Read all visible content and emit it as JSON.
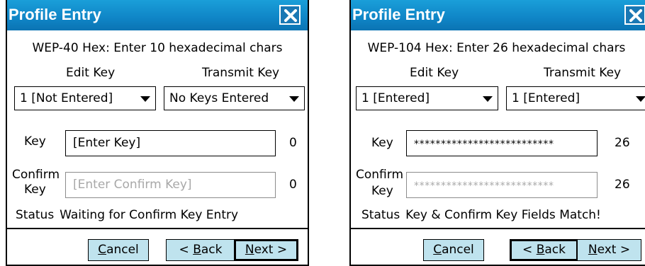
{
  "left": {
    "title": "Profile Entry",
    "heading": "WEP-40 Hex: Enter 10 hexadecimal chars",
    "edit_key_label": "Edit Key",
    "transmit_key_label": "Transmit Key",
    "edit_key_value": "1 [Not Entered]",
    "transmit_key_value": "No Keys Entered",
    "key_label": "Key",
    "key_value": "[Enter Key]",
    "key_count": "0",
    "confirm_label_1": "Confirm",
    "confirm_label_2": "Key",
    "confirm_placeholder": "[Enter Confirm Key]",
    "confirm_count": "0",
    "status_label": "Status",
    "status_value": "Waiting for Confirm Key Entry",
    "cancel_rest": "ancel",
    "back_rest": "ack",
    "next_rest": "ext >"
  },
  "right": {
    "title": "Profile Entry",
    "heading": "WEP-104 Hex: Enter 26 hexadecimal chars",
    "edit_key_label": "Edit Key",
    "transmit_key_label": "Transmit Key",
    "edit_key_value": "1 [Entered]",
    "transmit_key_value": "1 [Entered]",
    "key_label": "Key",
    "key_value": "**************************",
    "key_count": "26",
    "confirm_label_1": "Confirm",
    "confirm_label_2": "Key",
    "confirm_value": "**************************",
    "confirm_count": "26",
    "status_label": "Status",
    "status_value": "Key & Confirm Key Fields Match!",
    "cancel_rest": "ancel",
    "back_rest": "ack",
    "next_rest": "ext >"
  },
  "buttons": {
    "cancel_mnemonic": "C",
    "back_prefix": "< ",
    "back_mnemonic": "B",
    "next_mnemonic": "N"
  },
  "icons": {
    "close": "close-x-icon",
    "dropdown": "chevron-down-icon"
  },
  "colors": {
    "titlebar": "#0f85c6",
    "button_face": "#bfe3ee",
    "disabled_text": "#a8a8a8"
  }
}
